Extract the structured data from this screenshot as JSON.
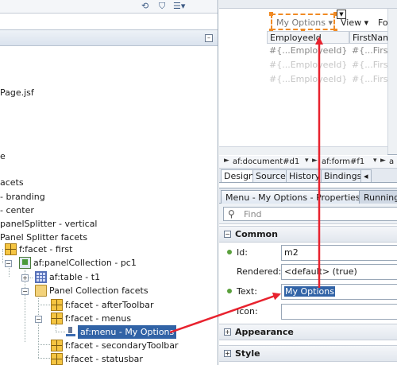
{
  "structure": {
    "file_label": "Page.jsf",
    "partial_e": "e",
    "partial_facets": "acets",
    "branding": "- branding",
    "center": "- center",
    "splitter": "panelSplitter - vertical",
    "splitter_facets": "Panel Splitter facets",
    "facet_first": "f:facet - first",
    "panel_collection": "af:panelCollection - pc1",
    "table": "af:table - t1",
    "panel_collection_facets": "Panel Collection facets",
    "facet_after_toolbar": "f:facet - afterToolbar",
    "facet_menus": "f:facet - menus",
    "menu_selected": "af:menu - My Options",
    "facet_secondary_toolbar": "f:facet - secondaryToolbar",
    "facet_statusbar": "f:facet - statusbar"
  },
  "design": {
    "menu_label": "My Options",
    "menu_arrow": "▾",
    "view_label": "View ▾",
    "format_label": "Format",
    "columns": [
      "EmployeeId",
      "FirstName"
    ],
    "rows": [
      [
        "#{...EmployeeId}",
        "#{...FirstNa"
      ],
      [
        "#{...EmployeeId}",
        "#{...FirstNa"
      ],
      [
        "#{...EmployeeId}",
        "#{...FirstNa"
      ]
    ]
  },
  "breadcrumb": {
    "items": [
      "af:document#d1",
      "af:form#f1",
      "a"
    ]
  },
  "editor_tabs": [
    "Design",
    "Source",
    "History",
    "Bindings"
  ],
  "properties": {
    "tab_title": "Menu - My Options - Properties",
    "tab_running": "Running",
    "find_placeholder": "Find",
    "section_common": "Common",
    "id_label": "Id:",
    "id_value": "m2",
    "rendered_label": "Rendered:",
    "rendered_value": "<default> (true)",
    "text_label": "Text:",
    "text_value": "My Options",
    "icon_label": "Icon:",
    "icon_value": "",
    "section_appearance": "Appearance",
    "section_style": "Style"
  },
  "colors": {
    "arrow": "#e8222e",
    "selection": "#3163a6",
    "dashed_border": "#f08a24"
  }
}
